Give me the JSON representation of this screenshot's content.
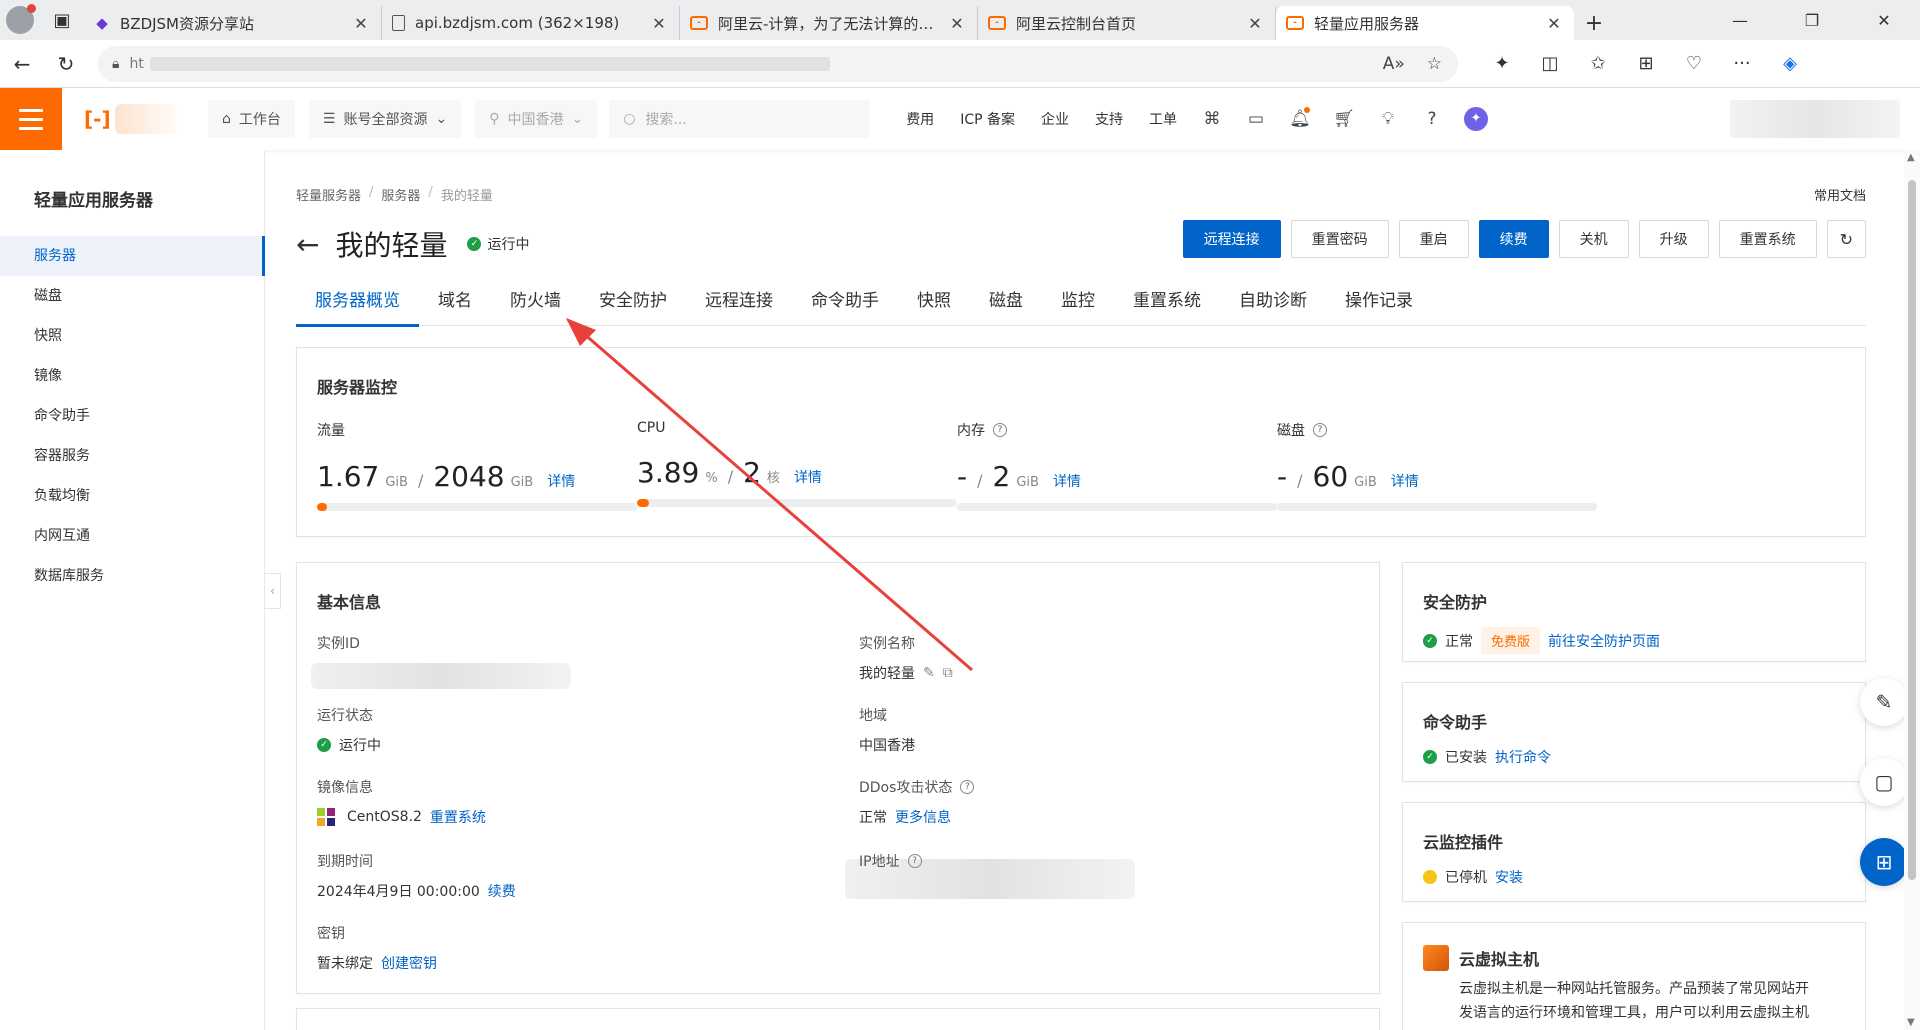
{
  "browser": {
    "tabs": [
      {
        "title": "BZDJSM资源分享站",
        "icon": "bzdjsm-favicon"
      },
      {
        "title": "api.bzdjsm.com (362×198)",
        "icon": "document-favicon"
      },
      {
        "title": "阿里云-计算，为了无法计算的价值",
        "icon": "aliyun-favicon"
      },
      {
        "title": "阿里云控制台首页",
        "icon": "aliyun-favicon"
      },
      {
        "title": "轻量应用服务器",
        "icon": "aliyun-favicon",
        "active": true
      }
    ],
    "url": "ht"
  },
  "header": {
    "workbench": "工作台",
    "resources": "账号全部资源",
    "region": "中国香港",
    "search_placeholder": "搜索...",
    "links": [
      "费用",
      "ICP 备案",
      "企业",
      "支持",
      "工单"
    ]
  },
  "sidebar": {
    "title": "轻量应用服务器",
    "items": [
      "服务器",
      "磁盘",
      "快照",
      "镜像",
      "命令助手",
      "容器服务",
      "负载均衡",
      "内网互通",
      "数据库服务"
    ]
  },
  "breadcrumb": [
    "轻量服务器",
    "服务器",
    "我的轻量"
  ],
  "doc_link": "常用文档",
  "page": {
    "title": "我的轻量",
    "status": "运行中"
  },
  "actions": [
    "远程连接",
    "重置密码",
    "重启",
    "续费",
    "关机",
    "升级",
    "重置系统"
  ],
  "tabs": [
    "服务器概览",
    "域名",
    "防火墙",
    "安全防护",
    "远程连接",
    "命令助手",
    "快照",
    "磁盘",
    "监控",
    "重置系统",
    "自助诊断",
    "操作记录"
  ],
  "monitor": {
    "title": "服务器监控",
    "detail": "详情",
    "traffic": {
      "label": "流量",
      "used": "1.67",
      "unit": "GiB",
      "total": "2048",
      "total_unit": "GiB",
      "fraction": 0.0008
    },
    "cpu": {
      "label": "CPU",
      "used": "3.89",
      "unit": "%",
      "total": "2",
      "total_unit": "核",
      "fraction": 0.0389
    },
    "memory": {
      "label": "内存",
      "used": "-",
      "total": "2",
      "total_unit": "GiB",
      "fraction": 0
    },
    "disk": {
      "label": "磁盘",
      "used": "-",
      "total": "60",
      "total_unit": "GiB",
      "fraction": 0
    }
  },
  "basic": {
    "title": "基本信息",
    "instance_id_label": "实例ID",
    "instance_name_label": "实例名称",
    "instance_name": "我的轻量",
    "run_status_label": "运行状态",
    "run_status": "运行中",
    "region_label": "地域",
    "region": "中国香港",
    "image_label": "镜像信息",
    "image": "CentOS8.2",
    "image_link": "重置系统",
    "ddos_label": "DDos攻击状态",
    "ddos": "正常",
    "ddos_link": "更多信息",
    "expire_label": "到期时间",
    "expire": "2024年4月9日 00:00:00",
    "expire_link": "续费",
    "ip_label": "IP地址",
    "key_label": "密钥",
    "key": "暂未绑定",
    "key_link": "创建密钥"
  },
  "security": {
    "title": "安全防护",
    "status": "正常",
    "tag": "免费版",
    "link": "前往安全防护页面"
  },
  "command": {
    "title": "命令助手",
    "status": "已安装",
    "link": "执行命令"
  },
  "cloudmon": {
    "title": "云监控插件",
    "status": "已停机",
    "link": "安装"
  },
  "vhost": {
    "title": "云虚拟主机",
    "line1": "云虚拟主机是一种网站托管服务。产品预装了常见网站开",
    "line2": "发语言的运行环境和管理工具，用户可以利用云虚拟主机"
  },
  "colors": {
    "accent": "#0064c8",
    "brand": "#ff6a00",
    "ok": "#1e9e46",
    "arrow": "#e8413c"
  }
}
